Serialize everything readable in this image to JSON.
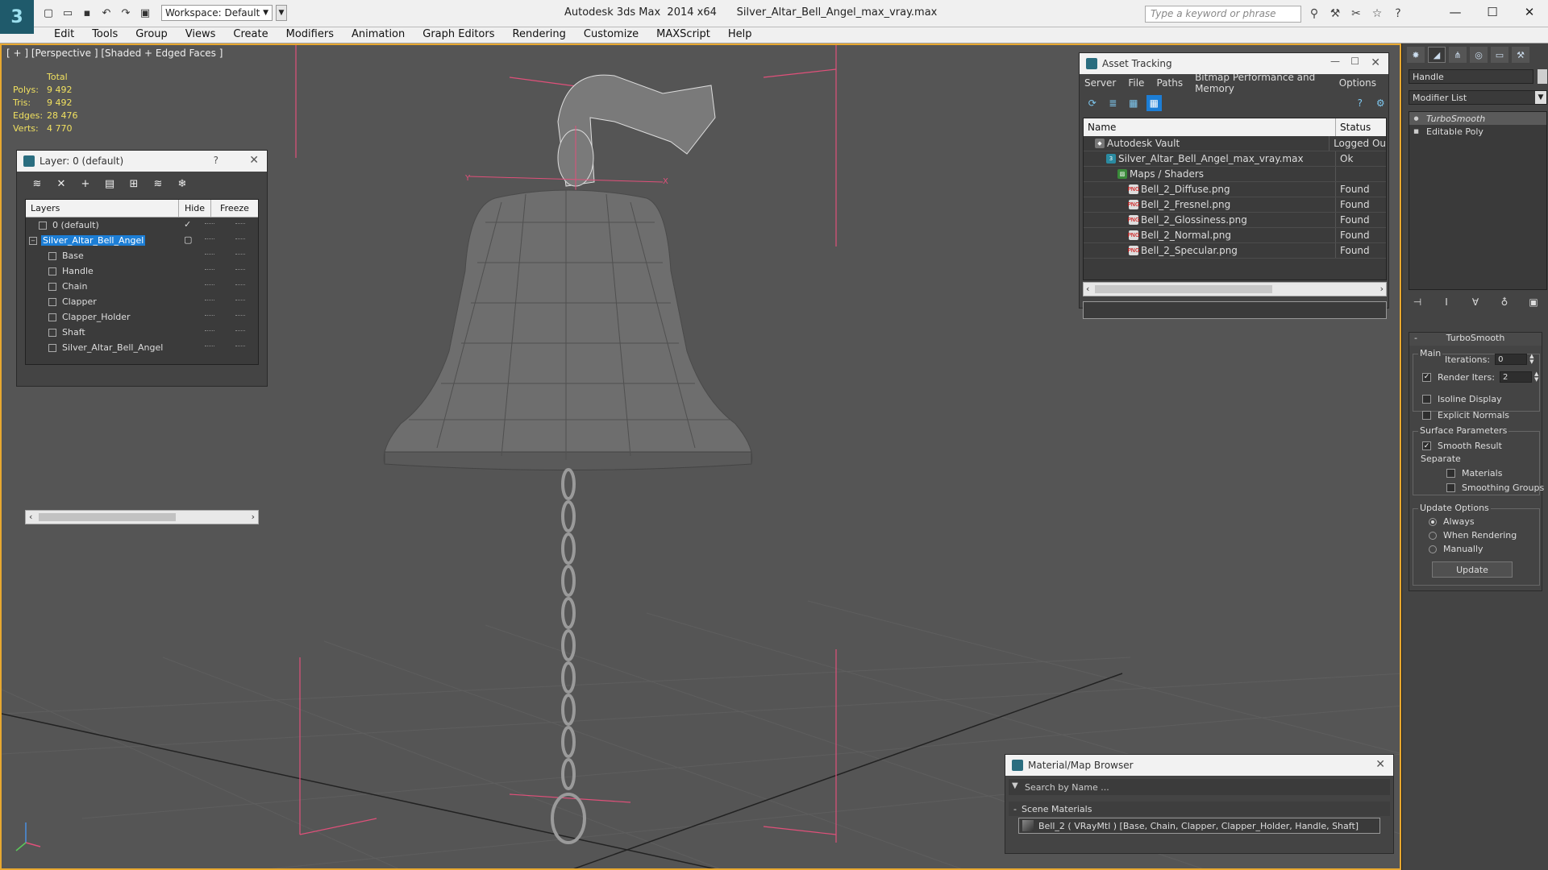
{
  "app": {
    "title": "Autodesk 3ds Max  2014 x64      Silver_Altar_Bell_Angel_max_vray.max",
    "logo_text": "3",
    "workspace": "Workspace: Default",
    "search_placeholder": "Type a keyword or phrase"
  },
  "menu": [
    "Edit",
    "Tools",
    "Group",
    "Views",
    "Create",
    "Modifiers",
    "Animation",
    "Graph Editors",
    "Rendering",
    "Customize",
    "MAXScript",
    "Help"
  ],
  "viewport": {
    "label": "[ + ] [Perspective ] [Shaded + Edged Faces ]",
    "stats": {
      "header": "Total",
      "rows": [
        {
          "k": "Polys:",
          "v": "9 492"
        },
        {
          "k": "Tris:",
          "v": "9 492"
        },
        {
          "k": "Edges:",
          "v": "28 476"
        },
        {
          "k": "Verts:",
          "v": "4 770"
        }
      ]
    },
    "axis_y": "Y",
    "axis_x": "X"
  },
  "layer_panel": {
    "title": "Layer: 0 (default)",
    "help": "?",
    "columns": {
      "layers": "Layers",
      "hide": "Hide",
      "freeze": "Freeze"
    },
    "rows": [
      {
        "name": "0 (default)",
        "indent": 1,
        "active": true
      },
      {
        "name": "Silver_Altar_Bell_Angel",
        "indent": 0,
        "selected": true
      },
      {
        "name": "Base",
        "indent": 2
      },
      {
        "name": "Handle",
        "indent": 2
      },
      {
        "name": "Chain",
        "indent": 2
      },
      {
        "name": "Clapper",
        "indent": 2
      },
      {
        "name": "Clapper_Holder",
        "indent": 2
      },
      {
        "name": "Shaft",
        "indent": 2
      },
      {
        "name": "Silver_Altar_Bell_Angel",
        "indent": 2
      }
    ]
  },
  "asset_panel": {
    "title": "Asset Tracking",
    "menu": [
      "Server",
      "File",
      "Paths",
      "Bitmap Performance and Memory",
      "Options"
    ],
    "columns": {
      "name": "Name",
      "status": "Status"
    },
    "rows": [
      {
        "name": "Autodesk Vault",
        "status": "Logged Ou",
        "indent": 1,
        "icon": "vault"
      },
      {
        "name": "Silver_Altar_Bell_Angel_max_vray.max",
        "status": "Ok",
        "indent": 2,
        "icon": "max"
      },
      {
        "name": "Maps / Shaders",
        "status": "",
        "indent": 3,
        "icon": "maps"
      },
      {
        "name": "Bell_2_Diffuse.png",
        "status": "Found",
        "indent": 4,
        "icon": "png"
      },
      {
        "name": "Bell_2_Fresnel.png",
        "status": "Found",
        "indent": 4,
        "icon": "png"
      },
      {
        "name": "Bell_2_Glossiness.png",
        "status": "Found",
        "indent": 4,
        "icon": "png"
      },
      {
        "name": "Bell_2_Normal.png",
        "status": "Found",
        "indent": 4,
        "icon": "png"
      },
      {
        "name": "Bell_2_Specular.png",
        "status": "Found",
        "indent": 4,
        "icon": "png"
      }
    ]
  },
  "material_panel": {
    "title": "Material/Map Browser",
    "search": "Search by Name ...",
    "section": "Scene Materials",
    "item": "Bell_2  ( VRayMtl )  [Base, Chain, Clapper, Clapper_Holder, Handle, Shaft]"
  },
  "command_panel": {
    "object_name": "Handle",
    "modifier_list": "Modifier List",
    "stack": [
      {
        "name": "TurboSmooth",
        "selected": true
      },
      {
        "name": "Editable Poly",
        "selected": false
      }
    ],
    "rollout": {
      "title": "TurboSmooth",
      "main_label": "Main",
      "iterations_label": "Iterations:",
      "iterations_value": "0",
      "render_iters_label": "Render Iters:",
      "render_iters_value": "2",
      "render_iters_checked": true,
      "isoline": "Isoline Display",
      "explicit": "Explicit Normals",
      "surface_label": "Surface Parameters",
      "smooth_result": "Smooth Result",
      "separate_label": "Separate",
      "materials": "Materials",
      "smoothing_groups": "Smoothing Groups",
      "update_label": "Update Options",
      "always": "Always",
      "when_rendering": "When Rendering",
      "manually": "Manually",
      "update_button": "Update"
    }
  },
  "colors": {
    "accent_blue": "#1c7ed6",
    "viewport_bg": "#555555",
    "stats_yellow": "#f0e060",
    "bbox_pink": "#e0507a",
    "active_border": "#e8a830"
  }
}
